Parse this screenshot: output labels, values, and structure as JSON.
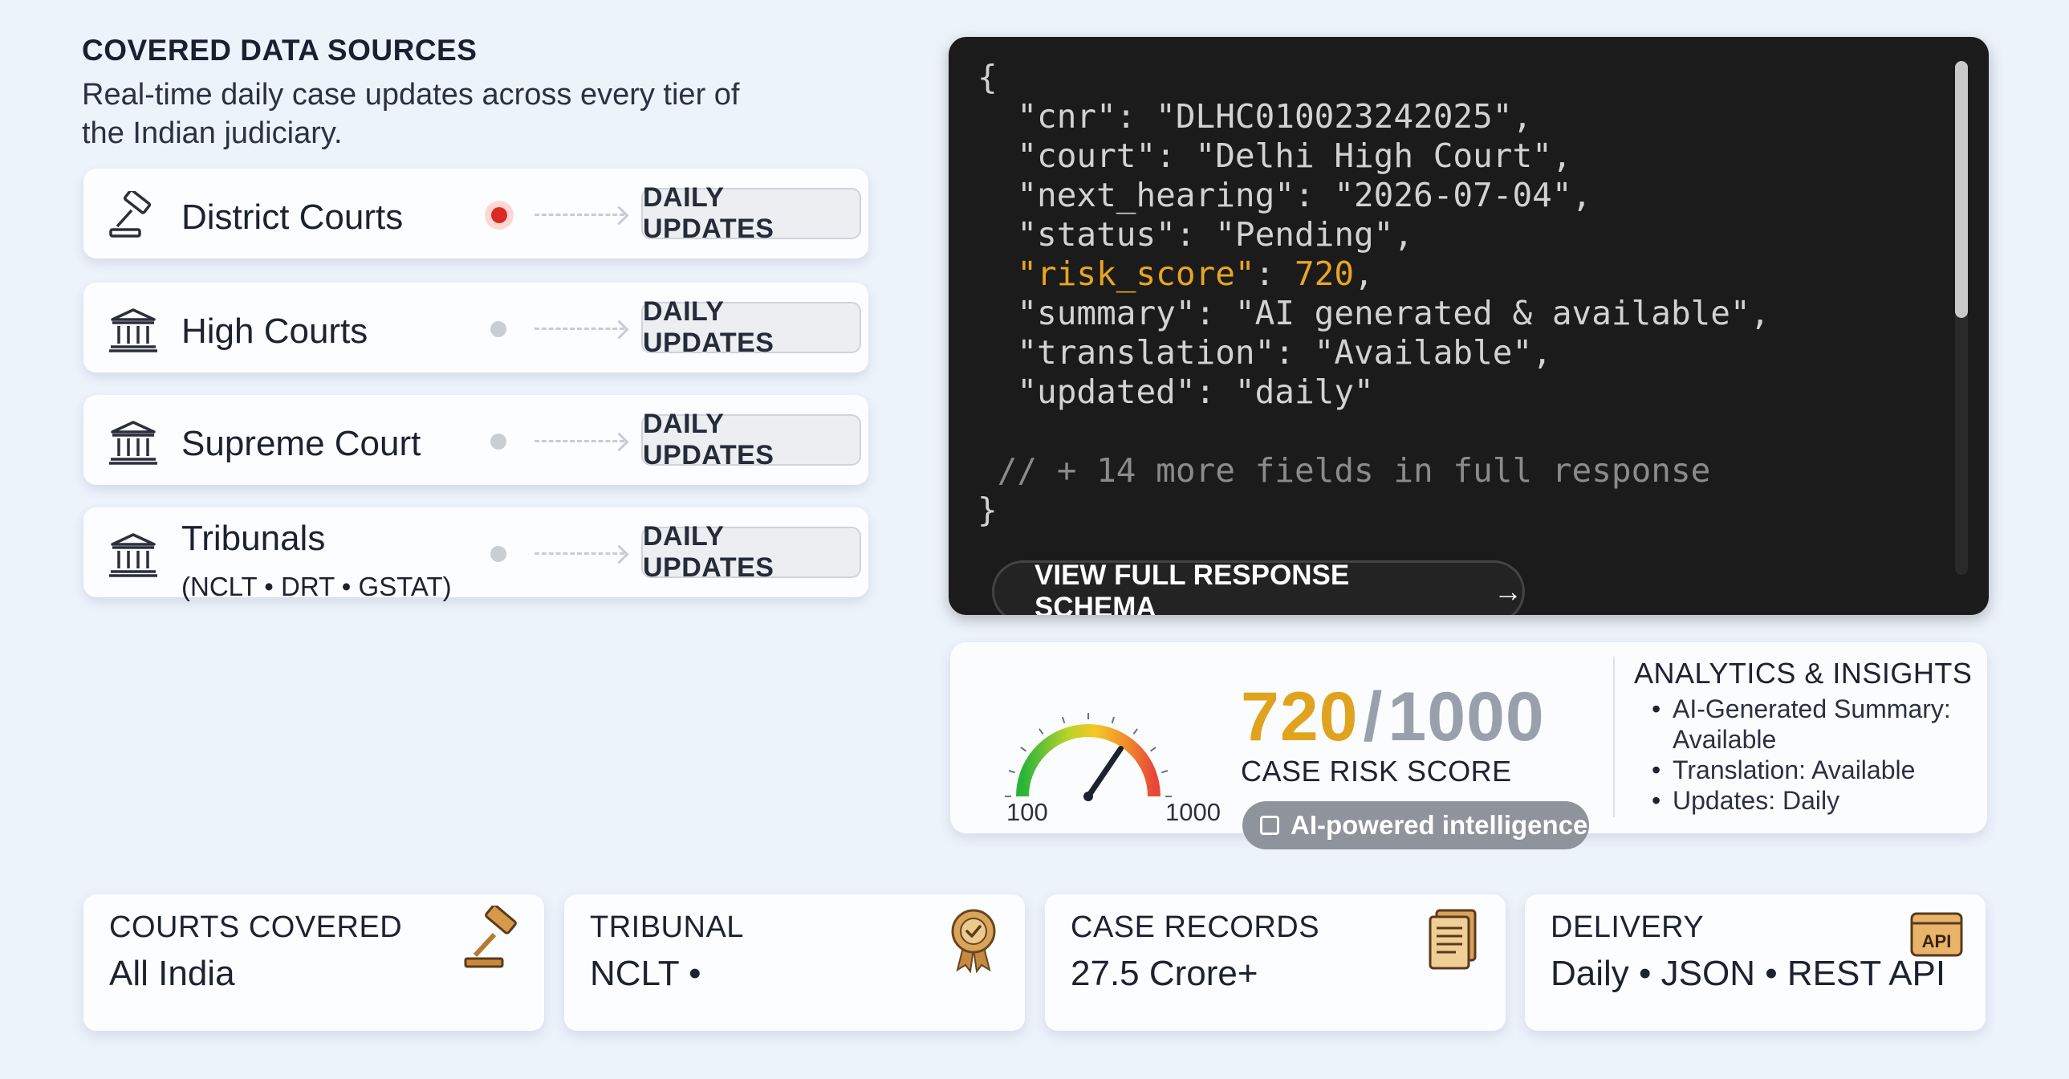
{
  "sources": {
    "heading": "COVERED DATA SOURCES",
    "description": "Real-time daily case updates across every tier of the Indian judiciary.",
    "items": [
      {
        "name": "District Courts",
        "sub": "",
        "badge": "DAILY UPDATES",
        "icon": "gavel-icon",
        "status": "live"
      },
      {
        "name": "High Courts",
        "sub": "",
        "badge": "DAILY UPDATES",
        "icon": "courthouse-icon",
        "status": "idle"
      },
      {
        "name": "Supreme Court",
        "sub": "",
        "badge": "DAILY UPDATES",
        "icon": "courthouse-icon",
        "status": "idle"
      },
      {
        "name": "Tribunals",
        "sub": "(NCLT • DRT • GSTAT)",
        "badge": "DAILY UPDATES",
        "icon": "courthouse-icon",
        "status": "idle"
      }
    ]
  },
  "code_panel": {
    "lines": [
      "{",
      "  \"cnr\": \"DLHC010023242025\",",
      "  \"court\": \"Delhi High Court\",",
      "  \"next_hearing\": \"2026-07-04\",",
      "  \"status\": \"Pending\",",
      "  \"risk_score\": 720,",
      "  \"summary\": \"AI generated & available\",",
      "  \"translation\": \"Available\",",
      "  \"updated\": \"daily\"",
      "",
      " // + 14 more fields in full response",
      "}"
    ],
    "highlight_key": "\"risk_score\"",
    "button_label": "VIEW FULL RESPONSE SCHEMA",
    "button_arrow": "→"
  },
  "risk": {
    "score": "720",
    "separator": "/",
    "max": "1000",
    "label": "CASE RISK SCORE",
    "gauge_min": "100",
    "gauge_max": "1000",
    "gauge_fraction": 0.69,
    "ai_badge": "AI-powered intelligence",
    "insights_title": "ANALYTICS & INSIGHTS",
    "insights": [
      "AI-Generated Summary: Available",
      "Translation: Available",
      "Updates: Daily"
    ]
  },
  "stats": [
    {
      "label": "COURTS COVERED",
      "value": "All India",
      "icon": "gavel-icon"
    },
    {
      "label": "TRIBUNAL",
      "value": "NCLT •",
      "icon": "award-badge-icon"
    },
    {
      "label": "CASE RECORDS",
      "value": "27.5 Crore+",
      "icon": "document-stack-icon"
    },
    {
      "label": "DELIVERY",
      "value": "Daily • JSON • REST API",
      "icon": "api-icon",
      "icon_text": "API"
    }
  ],
  "colors": {
    "background": "#edf3fb",
    "code_bg": "#1b1b1b",
    "highlight": "#e8a522",
    "score": "#e0a31e",
    "live_dot": "#d92b23"
  }
}
